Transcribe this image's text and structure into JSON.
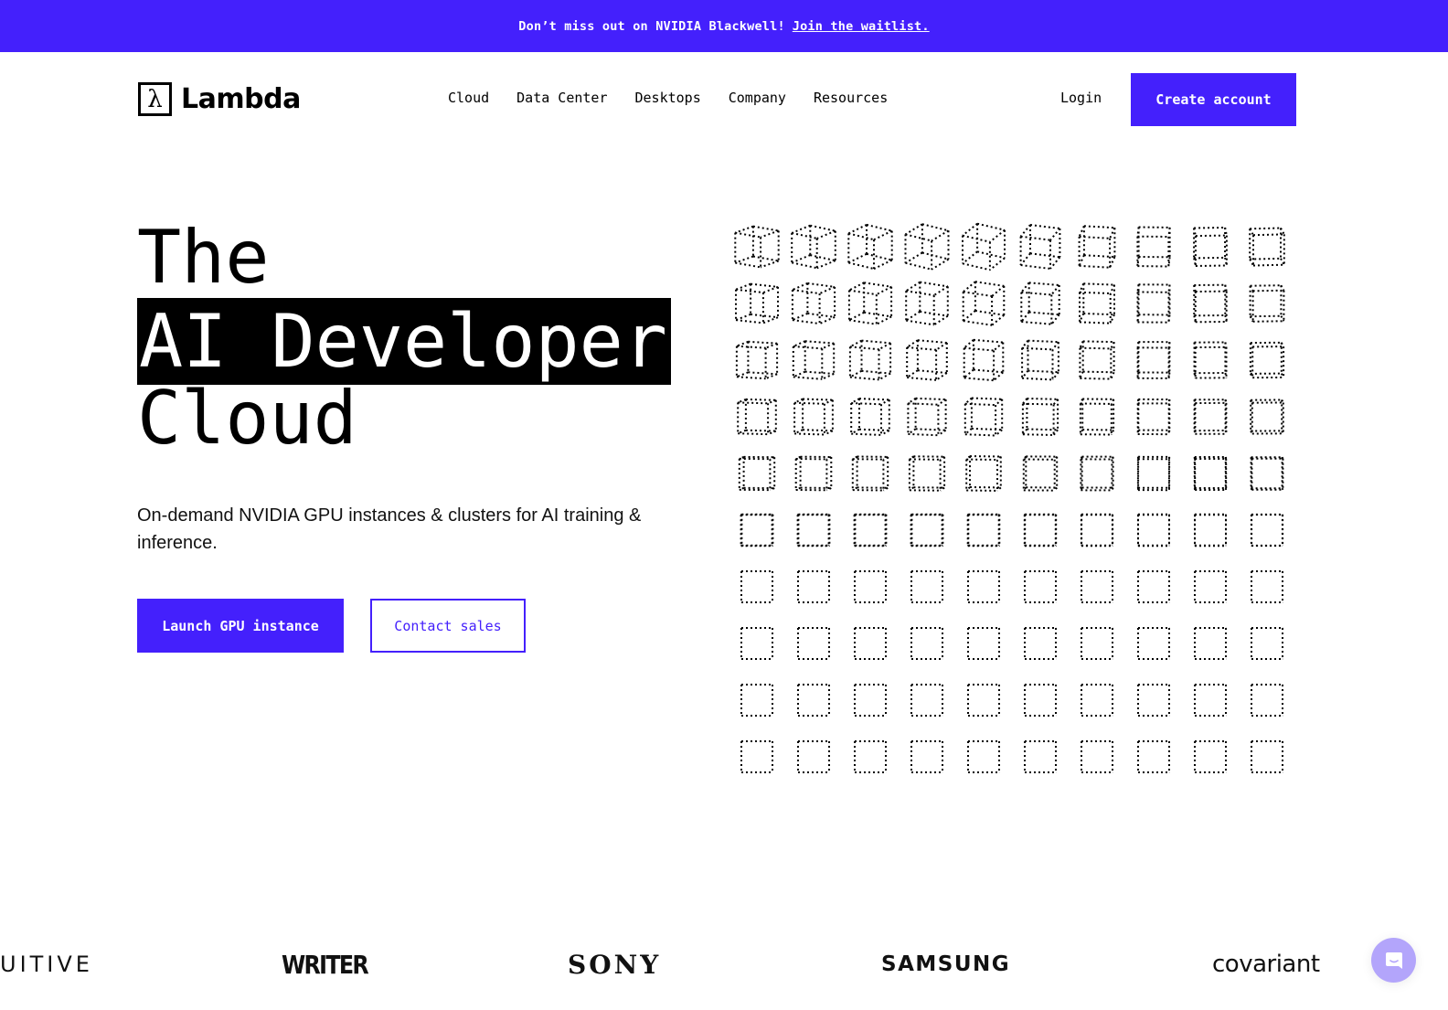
{
  "banner": {
    "text": "Don’t miss out on NVIDIA Blackwell!",
    "link_label": "Join the waitlist."
  },
  "header": {
    "logo_glyph": "λ",
    "logo_text": "Lambda",
    "nav": [
      {
        "label": "Cloud"
      },
      {
        "label": "Data Center"
      },
      {
        "label": "Desktops"
      },
      {
        "label": "Company"
      },
      {
        "label": "Resources"
      }
    ],
    "login_label": "Login",
    "create_account_label": "Create account"
  },
  "hero": {
    "title_line1": "The",
    "title_line2": "AI Developer",
    "title_line3": "Cloud",
    "subtitle": "On-demand NVIDIA GPU instances & clusters for AI training & inference.",
    "primary_cta": "Launch GPU instance",
    "secondary_cta": "Contact sales"
  },
  "graphic": {
    "type": "dotted-cube-grid",
    "rows": 10,
    "cols": 10
  },
  "customer_logos": [
    {
      "name": "intuitive",
      "label": "UITIVE"
    },
    {
      "name": "writer",
      "label": "WRITER"
    },
    {
      "name": "sony",
      "label": "SONY"
    },
    {
      "name": "samsung",
      "label": "SAMSUNG"
    },
    {
      "name": "covariant",
      "label": "covariant"
    }
  ],
  "colors": {
    "brand": "#4420fc",
    "chat_bubble": "#b3a5fb",
    "text": "#000000",
    "background": "#ffffff"
  },
  "icons": {
    "chat": "chat-bubble-icon",
    "logo": "lambda-icon"
  }
}
